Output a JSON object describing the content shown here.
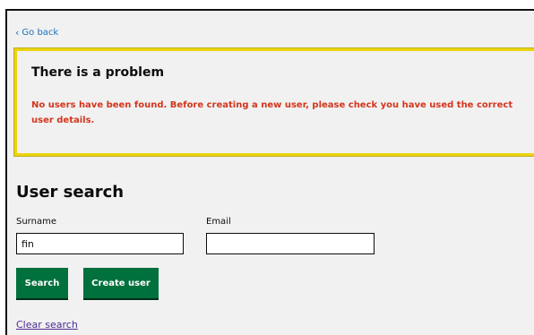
{
  "navigation": {
    "back_label": "Go back"
  },
  "error_summary": {
    "title": "There is a problem",
    "message": "No users have been found. Before creating a new user, please check you have used the correct user details."
  },
  "page": {
    "heading": "User search"
  },
  "form": {
    "surname_label": "Surname",
    "surname_value": "fin",
    "email_label": "Email",
    "email_value": ""
  },
  "buttons": {
    "search_label": "Search",
    "create_user_label": "Create user"
  },
  "links": {
    "clear_search_label": "Clear search"
  },
  "colors": {
    "link": "#1d70b8",
    "error_text": "#d4351c",
    "error_border": "#ebd40f",
    "button": "#00703c",
    "visited_link": "#4c2c92"
  },
  "icons": {
    "back": "chevron-left-icon"
  }
}
